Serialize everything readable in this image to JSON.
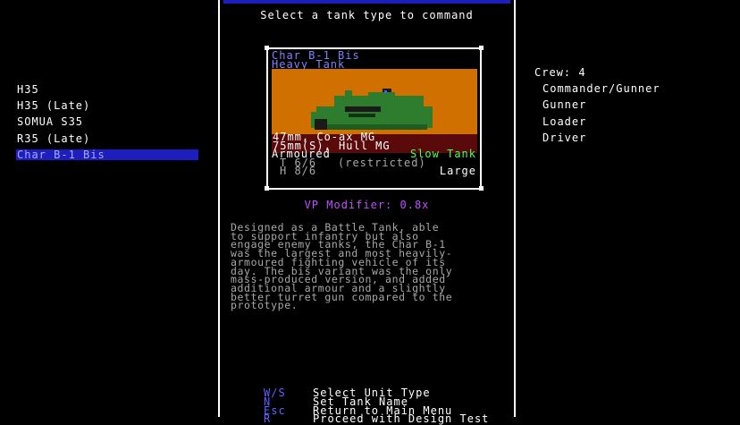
{
  "header": {
    "prompt": "Select a tank type to command"
  },
  "tank_list": [
    {
      "label": "H35",
      "selected": false
    },
    {
      "label": "H35 (Late)",
      "selected": false
    },
    {
      "label": "SOMUA S35",
      "selected": false
    },
    {
      "label": "R35 (Late)",
      "selected": false
    },
    {
      "label": "Char B-1 Bis",
      "selected": true
    }
  ],
  "card": {
    "name": "Char B-1 Bis",
    "class": "Heavy Tank",
    "armament_1": "47mm, Co-ax MG",
    "armament_2": "75mm(S), Hull MG",
    "armour": "Armoured",
    "speed": "Slow Tank",
    "turret_rating": "T 6/6",
    "restriction": "(restricted)",
    "hull_rating": "H 8/6",
    "size": "Large"
  },
  "vp_modifier": "VP Modifier: 0.8x",
  "description": "Designed as a Battle Tank, able\nto support infantry but also\nengage enemy tanks, the Char B-1\nwas the largest and most heavily-\narmoured fighting vehicle of its\nday. The bis variant was the only\nmass-produced version, and added\nadditional armour and a slightly\nbetter turret gun compared to the\nprototype.",
  "crew": {
    "label": "Crew: 4",
    "members": [
      "Commander/Gunner",
      "Gunner",
      "Loader",
      "Driver"
    ]
  },
  "controls": [
    {
      "key": "W/S",
      "label": "Select Unit Type"
    },
    {
      "key": "N",
      "label": "Set Tank Name"
    },
    {
      "key": "Esc",
      "label": "Return to Main Menu"
    },
    {
      "key": "R",
      "label": "Proceed with Design Test"
    }
  ],
  "colors": {
    "highlight": "#1e1ebe",
    "title": "#8080ff",
    "vp": "#c050ff",
    "speed": "#50ff50",
    "scene_bg": "#d07000",
    "hull": "#2e7d2e"
  }
}
